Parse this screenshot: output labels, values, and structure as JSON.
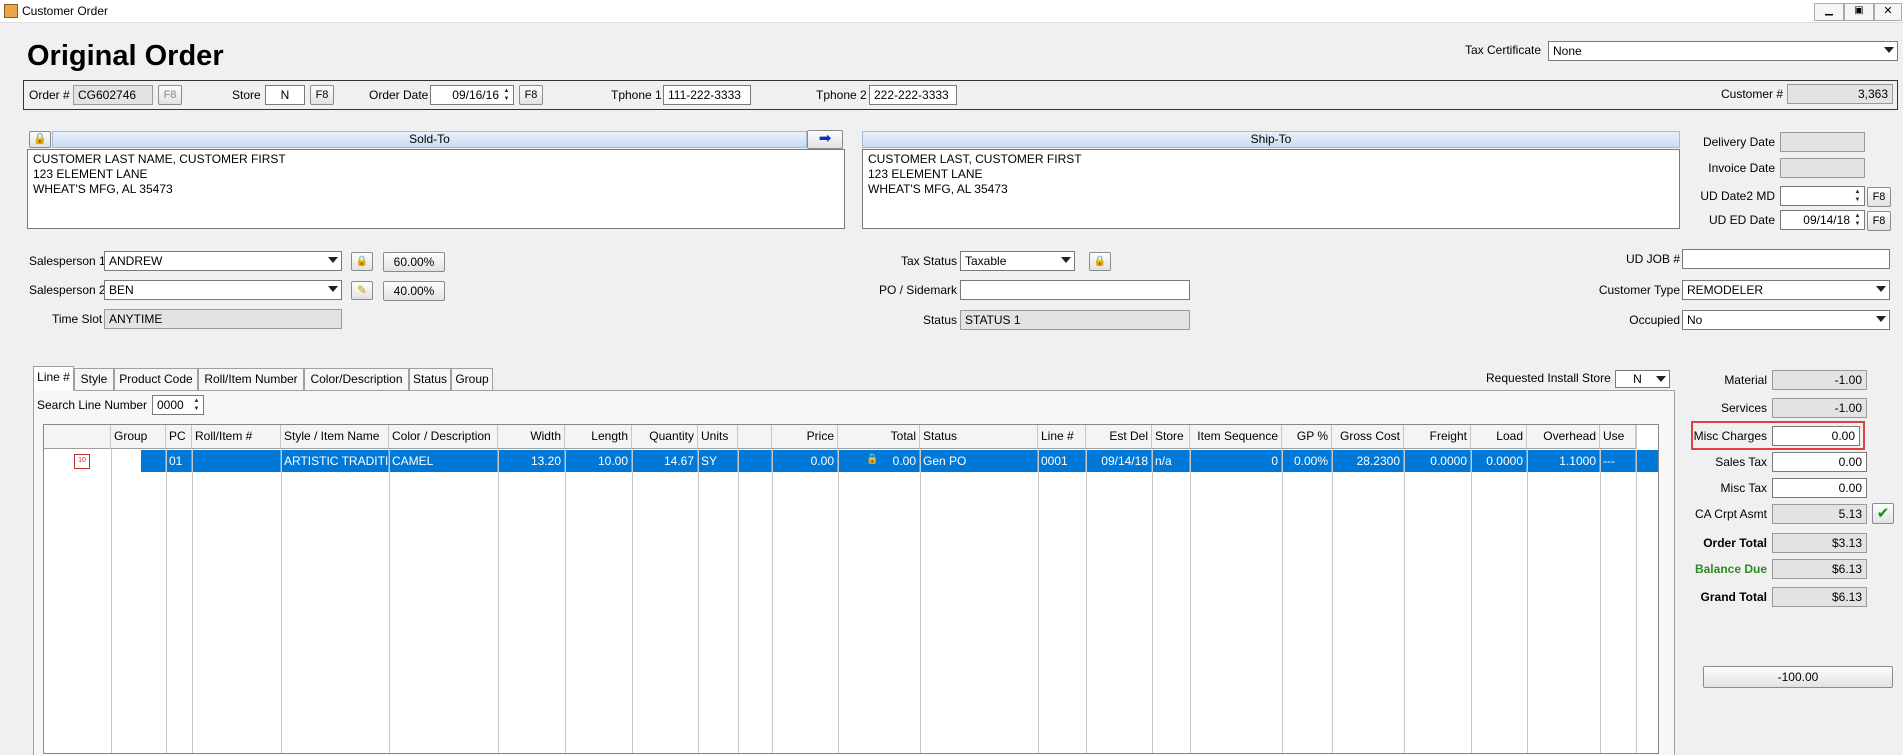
{
  "window": {
    "title": "Customer Order"
  },
  "page_title": "Original Order",
  "tax_certificate": {
    "label": "Tax Certificate",
    "value": "None"
  },
  "order_bar": {
    "order_label": "Order #",
    "order_value": "CG602746",
    "f8": "F8",
    "store_label": "Store",
    "store_value": "N",
    "order_date_label": "Order Date",
    "order_date_value": "09/16/16",
    "tphone1_label": "Tphone 1",
    "tphone1_value": "111-222-3333",
    "tphone2_label": "Tphone 2",
    "tphone2_value": "222-222-3333",
    "customer_label": "Customer #",
    "customer_value": "3,363"
  },
  "sold_to": {
    "header": "Sold-To",
    "lines": [
      "CUSTOMER LAST NAME, CUSTOMER FIRST",
      "123 ELEMENT LANE",
      "WHEAT'S MFG, AL  35473"
    ]
  },
  "ship_to": {
    "header": "Ship-To",
    "lines": [
      "CUSTOMER LAST, CUSTOMER FIRST",
      "123 ELEMENT LANE",
      "WHEAT'S MFG, AL  35473"
    ]
  },
  "dates": {
    "delivery_label": "Delivery Date",
    "delivery_value": "",
    "invoice_label": "Invoice Date",
    "invoice_value": "",
    "ud_date2_label": "UD Date2 MD",
    "ud_date2_value": "",
    "ud_ed_label": "UD ED Date",
    "ud_ed_value": "09/14/18"
  },
  "sales": {
    "sp1_label": "Salesperson 1",
    "sp1_value": "ANDREW",
    "sp1_pct": "60.00%",
    "sp2_label": "Salesperson 2",
    "sp2_value": "BEN",
    "sp2_pct": "40.00%",
    "timeslot_label": "Time Slot",
    "timeslot_value": "ANYTIME"
  },
  "middle": {
    "tax_status_label": "Tax Status",
    "tax_status_value": "Taxable",
    "po_label": "PO / Sidemark",
    "po_value": "",
    "status_label": "Status",
    "status_value": "STATUS 1"
  },
  "right_fields": {
    "ud_job_label": "UD JOB #",
    "ud_job_value": "",
    "customer_type_label": "Customer Type",
    "customer_type_value": "REMODELER",
    "occupied_label": "Occupied",
    "occupied_value": "No"
  },
  "tabs": [
    "Line #",
    "Style",
    "Product Code",
    "Roll/Item Number",
    "Color/Description",
    "Status",
    "Group"
  ],
  "requested_install_store": {
    "label": "Requested Install Store",
    "value": "N"
  },
  "search_line": {
    "label": "Search Line Number",
    "value": "0000"
  },
  "grid": {
    "headers": [
      "",
      "Group",
      "PC",
      "Roll/Item #",
      "Style / Item Name",
      "Color / Description",
      "Width",
      "Length",
      "Quantity",
      "Units",
      "",
      "Price",
      "Total",
      "Status",
      "Line #",
      "Est Del",
      "Store",
      "Item Sequence",
      "GP %",
      "Gross Cost",
      "Freight",
      "Load",
      "Overhead",
      "Use"
    ],
    "row": [
      "",
      "",
      "01",
      "",
      "ARTISTIC TRADITION",
      "CAMEL",
      "13.20",
      "10.00",
      "14.67",
      "SY",
      "",
      "0.00",
      "0.00",
      "Gen PO",
      "0001",
      "09/14/18",
      "n/a",
      "0",
      "0.00%",
      "28.2300",
      "0.0000",
      "0.0000",
      "1.1000",
      "---"
    ]
  },
  "totals": {
    "material_label": "Material",
    "material_value": "-1.00",
    "services_label": "Services",
    "services_value": "-1.00",
    "misc_charges_label": "Misc Charges",
    "misc_charges_value": "0.00",
    "sales_tax_label": "Sales Tax",
    "sales_tax_value": "0.00",
    "misc_tax_label": "Misc Tax",
    "misc_tax_value": "0.00",
    "ca_label": "CA Crpt Asmt",
    "ca_value": "5.13",
    "order_total_label": "Order Total",
    "order_total_value": "$3.13",
    "balance_due_label": "Balance Due",
    "balance_due_value": "$6.13",
    "grand_total_label": "Grand Total",
    "grand_total_value": "$6.13",
    "bottom_button": "-100.00"
  },
  "colors": {
    "selection": "#0078d7",
    "highlight_box": "#e04040",
    "balance_due": "#2e8b22"
  }
}
